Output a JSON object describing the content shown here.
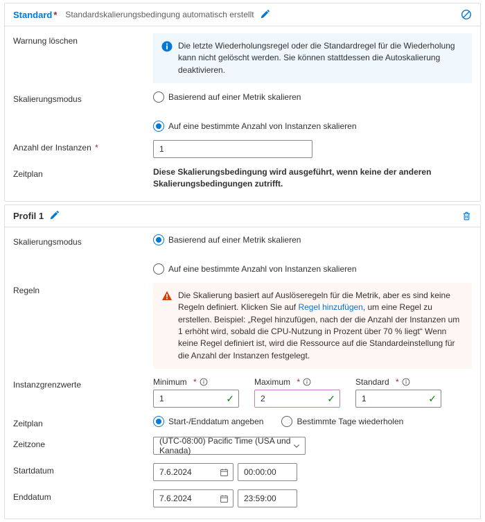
{
  "standard": {
    "title": "Standard",
    "subtitle": "Standardskalierungsbedingung automatisch erstellt",
    "rows": {
      "warn_label": "Warnung löschen",
      "info_text": "Die letzte Wiederholungsregel oder die Standardregel für die Wiederholung kann nicht gelöscht werden. Sie können stattdessen die Autoskalierung deaktivieren.",
      "mode_label": "Skalierungsmodus",
      "mode_opt_metric": "Basierend auf einer Metrik skalieren",
      "mode_opt_fixed": "Auf eine bestimmte Anzahl von Instanzen skalieren",
      "count_label": "Anzahl der Instanzen",
      "count_value": "1",
      "schedule_label": "Zeitplan",
      "schedule_note": "Diese Skalierungsbedingung wird ausgeführt, wenn keine der anderen Skalierungsbedingungen zutrifft."
    }
  },
  "profile1": {
    "title": "Profil 1",
    "rows": {
      "mode_label": "Skalierungsmodus",
      "mode_opt_metric": "Basierend auf einer Metrik skalieren",
      "mode_opt_fixed": "Auf eine bestimmte Anzahl von Instanzen skalieren",
      "rules_label": "Regeln",
      "rules_warn_pre": "Die Skalierung basiert auf Auslöseregeln für die Metrik, aber es sind keine Regeln definiert. Klicken Sie auf ",
      "rules_warn_link": "Regel hinzufügen",
      "rules_warn_post": ", um eine Regel zu erstellen. Beispiel: „Regel hinzufügen, nach der die Anzahl der Instanzen um 1 erhöht wird, sobald die CPU-Nutzung in Prozent über 70 % liegt“ Wenn keine Regel definiert ist, wird die Ressource auf die Standardeinstellung für die Anzahl der Instanzen festgelegt.",
      "limits_label": "Instanzgrenzwerte",
      "min_label": "Minimum",
      "min_value": "1",
      "max_label": "Maximum",
      "max_value": "2",
      "def_label": "Standard",
      "def_value": "1",
      "schedule_label": "Zeitplan",
      "sched_opt_range": "Start-/Enddatum angeben",
      "sched_opt_repeat": "Bestimmte Tage wiederholen",
      "tz_label": "Zeitzone",
      "tz_value": "(UTC-08:00) Pacific Time (USA und Kanada)",
      "start_label": "Startdatum",
      "start_date": "7.6.2024",
      "start_time": "00:00:00",
      "end_label": "Enddatum",
      "end_date": "7.6.2024",
      "end_time": "23:59:00"
    }
  }
}
